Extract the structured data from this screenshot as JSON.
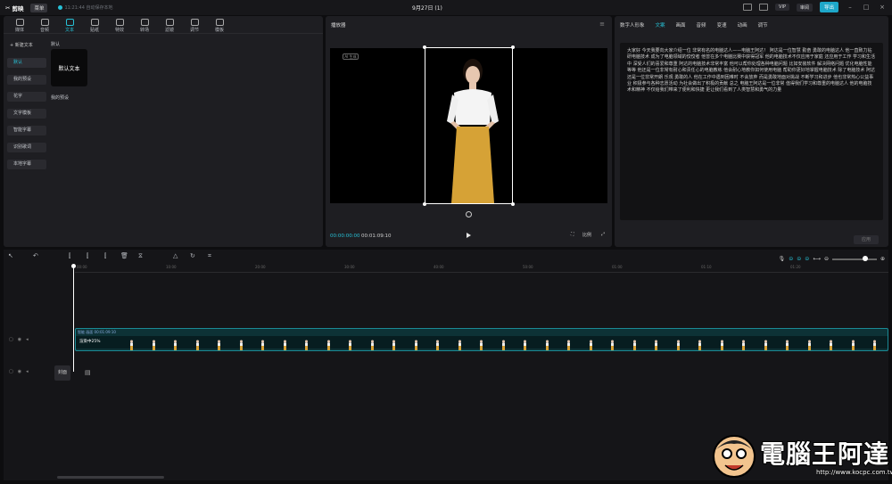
{
  "titlebar": {
    "app_name": "剪映",
    "menu_label": "菜单",
    "save_status": "11:21:44 自动保存本地",
    "doc_title": "9月27日 (1)",
    "vip_label": "VIP",
    "share_label": "审阅",
    "export_label": "导出"
  },
  "top_tabs": [
    {
      "label": "媒体"
    },
    {
      "label": "音频"
    },
    {
      "label": "文本",
      "active": true
    },
    {
      "label": "贴纸"
    },
    {
      "label": "特效"
    },
    {
      "label": "转场"
    },
    {
      "label": "滤镜"
    },
    {
      "label": "调节"
    },
    {
      "label": "模板"
    }
  ],
  "side_nav": [
    {
      "label": "+ 新建文本",
      "head": true
    },
    {
      "label": "默认",
      "active": true
    },
    {
      "label": "我的预设"
    },
    {
      "label": "花字"
    },
    {
      "label": "文字模板"
    },
    {
      "label": "智能字幕"
    },
    {
      "label": "识别歌词"
    },
    {
      "label": "本地字幕"
    }
  ],
  "library": {
    "section_default": "默认",
    "default_tile": "默认文本",
    "section_presets": "我的预设"
  },
  "player": {
    "title": "播放器",
    "ai_label": "AI 生成",
    "timecode_current": "00:00:00:00",
    "timecode_total": "00:01:09:10",
    "ratio_label": "比例"
  },
  "props": {
    "tabs": [
      {
        "label": "数字人形象"
      },
      {
        "label": "文案",
        "active": true
      },
      {
        "label": "画面"
      },
      {
        "label": "音频"
      },
      {
        "label": "变速"
      },
      {
        "label": "动画"
      },
      {
        "label": "调节"
      }
    ],
    "script_text": "大家好 今天我要向大家介绍一位 非常有名的电脑达人——电脑王阿达！ 阿达是一位智慧 勤奋 勇敢的电脑达人 他一直致力钻研电脑技术 成为了电脑领域的佼佼者 他曾在多个电脑比赛中获得冠军 他的电脑技术不仅应用于家庭 还应用于工作 学习和生活中 深受人们的喜爱和尊重 阿达的电脑技术非常丰富 他可以帮你处理各种电脑问题 比如安装软件 解决网络问题 优化电脑性能等等 他还是一位非常有耐心和责任心的电脑教练 他会耐心地教你如何使用电脑 帮助你更好地掌握电脑技术 除了电脑技术 阿达还是一位非常开朗 乐观 勇敢的人 他在工作中遇到困难时 不会放弃 而是勇敢地面对挑战 不断学习和进步 他也非常热心公益事业 积极参与各种志愿活动 为社会做出了积极的贡献 总之 电脑王阿达是一位非常 值得我们学习和尊重的电脑达人 他的电脑技术和精神 不仅给我们带来了便利和快捷 更让我们看到了人类智慧和勇气的力量",
    "apply_label": "应用"
  },
  "timeline": {
    "ruler_ticks": [
      "00:00",
      "10:00",
      "20:00",
      "30:00",
      "40:00",
      "50:00",
      "01:00",
      "01:10",
      "01:20"
    ],
    "track_header": "智能 画面 00:01:09:10",
    "track_label": "渲染中25%",
    "cover_label": "封面"
  },
  "watermark": {
    "text": "電腦王阿達",
    "url": "http://www.kocpc.com.tw"
  },
  "colors": {
    "accent": "#27c1d6",
    "bg": "#0d0d0f",
    "panel": "#1e1e22"
  }
}
